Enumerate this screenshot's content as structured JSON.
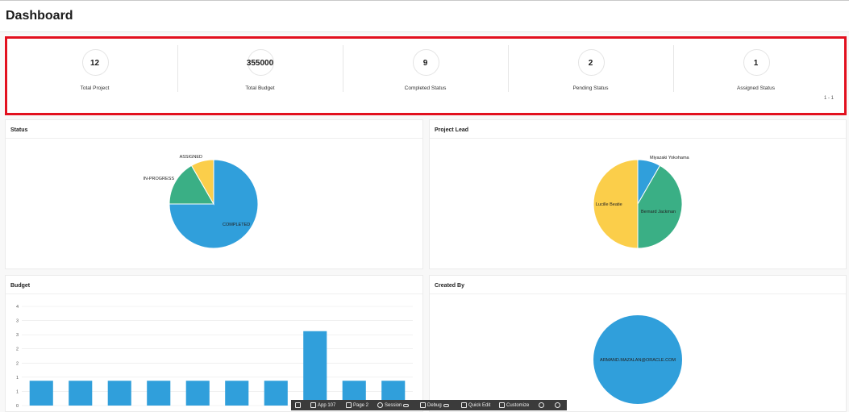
{
  "page": {
    "title": "Dashboard"
  },
  "metrics": [
    {
      "value": "12",
      "label": "Total Project"
    },
    {
      "value": "355000",
      "label": "Total Budget"
    },
    {
      "value": "9",
      "label": "Completed Status"
    },
    {
      "value": "2",
      "label": "Pending Status"
    },
    {
      "value": "1",
      "label": "Assigned Status"
    }
  ],
  "metrics_pagination": "1 - 1",
  "cards": {
    "status": {
      "title": "Status"
    },
    "project_lead": {
      "title": "Project Lead"
    },
    "budget": {
      "title": "Budget"
    },
    "created_by": {
      "title": "Created By"
    }
  },
  "chart_data": [
    {
      "type": "pie",
      "title": "Status",
      "labels": [
        "COMPLETED",
        "IN-PROGRESS",
        "ASSIGNED"
      ],
      "values": [
        9,
        2,
        1
      ],
      "colors": [
        "#309fdb",
        "#3aaf85",
        "#fbce4a"
      ]
    },
    {
      "type": "pie",
      "title": "Project Lead",
      "labels": [
        "Miyazaki Yokohama",
        "Bernard Jackman",
        "Lucille Beatie"
      ],
      "values": [
        1,
        5,
        6
      ],
      "colors": [
        "#309fdb",
        "#3aaf85",
        "#fbce4a"
      ]
    },
    {
      "type": "bar",
      "title": "Budget",
      "ylim": [
        0,
        4
      ],
      "yticks": [
        "0",
        "1",
        "1",
        "2",
        "2",
        "3",
        "3",
        "4"
      ],
      "values": [
        1,
        1,
        1,
        1,
        1,
        1,
        1,
        3,
        1,
        1
      ],
      "color": "#309fdb",
      "grid": true
    },
    {
      "type": "pie",
      "title": "Created By",
      "labels": [
        "ARMAND.MAZALAN@ORACLE.COM"
      ],
      "values": [
        12
      ],
      "colors": [
        "#309fdb"
      ]
    }
  ],
  "dev_toolbar": {
    "items": [
      "App 107",
      "Page 2",
      "Session",
      "Debug",
      "Quick Edit",
      "Customize"
    ],
    "icons": [
      "home-icon",
      "edit-icon",
      "page-icon",
      "session-icon",
      "debug-icon",
      "quick-edit-icon",
      "customize-icon",
      "info-icon",
      "settings-icon"
    ]
  }
}
